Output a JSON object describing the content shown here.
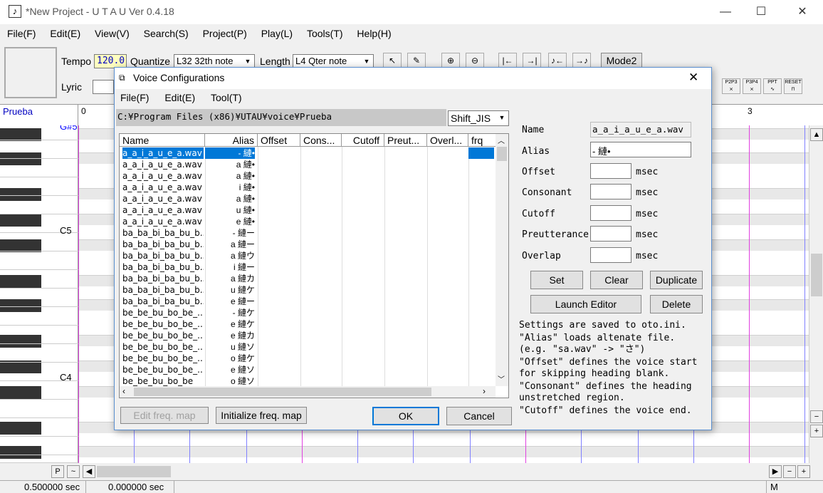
{
  "window": {
    "title": "*New Project - U T A U Ver 0.4.18",
    "minimize": "—",
    "maximize": "☐",
    "close": "✕"
  },
  "menu": [
    "File(F)",
    "Edit(E)",
    "View(V)",
    "Search(S)",
    "Project(P)",
    "Play(L)",
    "Tools(T)",
    "Help(H)"
  ],
  "toolbar": {
    "tempo_label": "Tempo",
    "tempo_value": "120.0",
    "quantize_label": "Quantize",
    "quantize_value": "L32 32th note",
    "length_label": "Length",
    "length_value": "L4  Qter note",
    "lyric_label": "Lyric",
    "mode_button": "Mode2",
    "env_buttons": [
      "P2P3",
      "P3P4",
      "PPT",
      "RESET"
    ]
  },
  "roll": {
    "track_name": "Prueba",
    "measure_start": "0",
    "measure_3": "3",
    "note_labels": {
      "gs5": "G#5",
      "c5": "C5",
      "c4": "C4"
    }
  },
  "status": {
    "left_time": "0.500000 sec",
    "mid_time": "0.000000 sec",
    "mode": "M",
    "p_button": "P"
  },
  "dialog": {
    "title": "Voice Configurations",
    "close": "✕",
    "menu": [
      "File(F)",
      "Edit(E)",
      "Tool(T)"
    ],
    "path": "C:¥Program Files (x86)¥UTAU¥voice¥Prueba",
    "encoding": "Shift_JIS",
    "columns": [
      "Name",
      "Alias",
      "Offset",
      "Cons...",
      "Cutoff",
      "Preut...",
      "Overl...",
      "frq"
    ],
    "rows": [
      {
        "name": "a_a_i_a_u_e_a.wav",
        "alias": "- 縺•"
      },
      {
        "name": "a_a_i_a_u_e_a.wav",
        "alias": "a 縺•"
      },
      {
        "name": "a_a_i_a_u_e_a.wav",
        "alias": "a 縺•"
      },
      {
        "name": "a_a_i_a_u_e_a.wav",
        "alias": "i 縺•"
      },
      {
        "name": "a_a_i_a_u_e_a.wav",
        "alias": "a 縺•"
      },
      {
        "name": "a_a_i_a_u_e_a.wav",
        "alias": "u 縺•"
      },
      {
        "name": "a_a_i_a_u_e_a.wav",
        "alias": "e 縺•"
      },
      {
        "name": "ba_ba_bi_ba_bu_b...",
        "alias": "- 縺ー"
      },
      {
        "name": "ba_ba_bi_ba_bu_b...",
        "alias": "a 縺ー"
      },
      {
        "name": "ba_ba_bi_ba_bu_b...",
        "alias": "a 縺ウ"
      },
      {
        "name": "ba_ba_bi_ba_bu_b...",
        "alias": "i 縺ー"
      },
      {
        "name": "ba_ba_bi_ba_bu_b...",
        "alias": "a 縺カ"
      },
      {
        "name": "ba_ba_bi_ba_bu_b...",
        "alias": "u 縺ケ"
      },
      {
        "name": "ba_ba_bi_ba_bu_b...",
        "alias": "e 縺ー"
      },
      {
        "name": "be_be_bu_bo_be_...",
        "alias": "- 縺ケ"
      },
      {
        "name": "be_be_bu_bo_be_...",
        "alias": "e 縺ケ"
      },
      {
        "name": "be_be_bu_bo_be_...",
        "alias": "e 縺カ"
      },
      {
        "name": "be_be_bu_bo_be_...",
        "alias": "u 縺ソ"
      },
      {
        "name": "be_be_bu_bo_be_...",
        "alias": "o 縺ケ"
      },
      {
        "name": "be_be_bu_bo_be_...",
        "alias": "e 縺ソ"
      },
      {
        "name": "be_be_bu_bo_be",
        "alias": "o 縺ソ"
      }
    ],
    "props": {
      "name_label": "Name",
      "name_value": "a_a_i_a_u_e_a.wav",
      "alias_label": "Alias",
      "alias_value": "- 縺•",
      "offset_label": "Offset",
      "consonant_label": "Consonant",
      "cutoff_label": "Cutoff",
      "preutterance_label": "Preutterance",
      "overlap_label": "Overlap",
      "unit": "msec"
    },
    "buttons": {
      "set": "Set",
      "clear": "Clear",
      "duplicate": "Duplicate",
      "launch_editor": "Launch Editor",
      "delete": "Delete",
      "edit_freq": "Edit freq. map",
      "init_freq": "Initialize freq. map",
      "ok": "OK",
      "cancel": "Cancel"
    },
    "help": [
      "Settings are saved to oto.ini.",
      "\"Alias\" loads altenate file. (e.g. \"sa.wav\" -> \"さ\")",
      "\"Offset\" defines the voice start for skipping heading blank.",
      "\"Consonant\" defines the heading unstretched region.",
      "\"Cutoff\" defines the voice end."
    ]
  },
  "colors": {
    "selection": "#0078d7",
    "measure_line": "#e040e0",
    "beat_line": "#8080ff",
    "note_label": "#0000ff"
  }
}
